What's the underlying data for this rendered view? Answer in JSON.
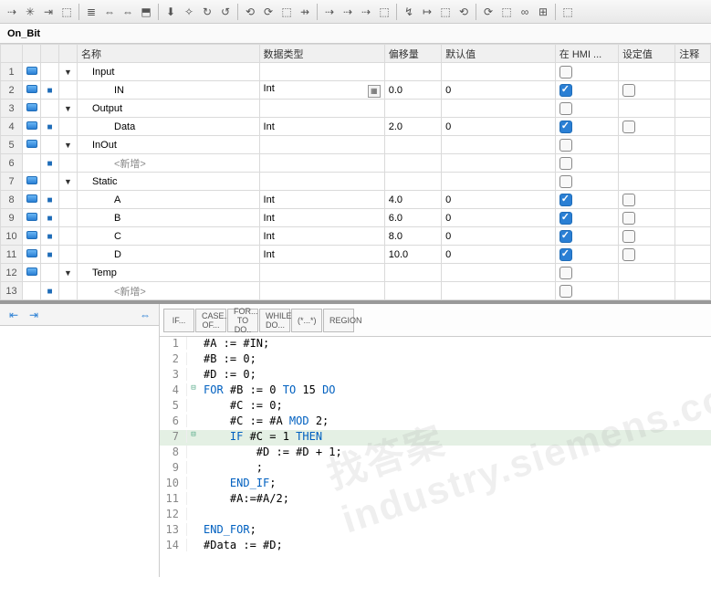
{
  "title": "On_Bit",
  "toolbar_icons": [
    "⇢",
    "✳",
    "⇥",
    "⬚",
    "≣",
    "⇔",
    "⇔",
    "⬒",
    "⬇",
    "✧",
    "↻",
    "↺",
    "⟲",
    "⟳",
    "⬚",
    "⇸",
    "⇢",
    "⇢",
    "⇢",
    "⬚",
    "↯",
    "↦",
    "⬚",
    "⟲",
    "⟳",
    "⬚",
    "∞",
    "⊞",
    "⬚"
  ],
  "columns": {
    "name": "名称",
    "type": "数据类型",
    "offset": "偏移量",
    "default": "默认值",
    "hmi": "在 HMI ...",
    "setpoint": "设定值",
    "comment": "注释"
  },
  "rows": [
    {
      "n": "1",
      "icon": "db",
      "tri": "▼",
      "name": "Input",
      "type": "",
      "off": "",
      "def": "",
      "hmi": false,
      "set": null,
      "ind": 1
    },
    {
      "n": "2",
      "icon": "db",
      "tri": "",
      "dot": true,
      "name": "IN",
      "type": "Int",
      "dd": true,
      "off": "0.0",
      "def": "0",
      "hmi": true,
      "set": false,
      "ind": 2
    },
    {
      "n": "3",
      "icon": "db",
      "tri": "▼",
      "name": "Output",
      "type": "",
      "off": "",
      "def": "",
      "hmi": false,
      "set": null,
      "ind": 1
    },
    {
      "n": "4",
      "icon": "db",
      "tri": "",
      "dot": true,
      "name": "Data",
      "type": "Int",
      "off": "2.0",
      "def": "0",
      "hmi": true,
      "set": false,
      "ind": 2
    },
    {
      "n": "5",
      "icon": "db",
      "tri": "▼",
      "name": "InOut",
      "type": "",
      "off": "",
      "def": "",
      "hmi": false,
      "set": null,
      "ind": 1
    },
    {
      "n": "6",
      "icon": "",
      "tri": "",
      "dot": true,
      "name": "<新增>",
      "type": "",
      "off": "",
      "def": "",
      "hmi": false,
      "set": null,
      "ind": 2,
      "new": true
    },
    {
      "n": "7",
      "icon": "db",
      "tri": "▼",
      "name": "Static",
      "type": "",
      "off": "",
      "def": "",
      "hmi": false,
      "set": null,
      "ind": 1
    },
    {
      "n": "8",
      "icon": "db",
      "tri": "",
      "dot": true,
      "name": "A",
      "type": "Int",
      "off": "4.0",
      "def": "0",
      "hmi": true,
      "set": false,
      "ind": 2
    },
    {
      "n": "9",
      "icon": "db",
      "tri": "",
      "dot": true,
      "name": "B",
      "type": "Int",
      "off": "6.0",
      "def": "0",
      "hmi": true,
      "set": false,
      "ind": 2
    },
    {
      "n": "10",
      "icon": "db",
      "tri": "",
      "dot": true,
      "name": "C",
      "type": "Int",
      "off": "8.0",
      "def": "0",
      "hmi": true,
      "set": false,
      "ind": 2
    },
    {
      "n": "11",
      "icon": "db",
      "tri": "",
      "dot": true,
      "name": "D",
      "type": "Int",
      "off": "10.0",
      "def": "0",
      "hmi": true,
      "set": false,
      "ind": 2
    },
    {
      "n": "12",
      "icon": "db",
      "tri": "▼",
      "name": "Temp",
      "type": "",
      "off": "",
      "def": "",
      "hmi": false,
      "set": null,
      "ind": 1
    },
    {
      "n": "13",
      "icon": "",
      "tri": "",
      "dot": true,
      "name": "<新增>",
      "type": "",
      "off": "",
      "def": "",
      "hmi": false,
      "set": null,
      "ind": 2,
      "new": true
    }
  ],
  "code_tabs": [
    "IF...",
    "CASE... OF...",
    "FOR... TO DO..",
    "WHILE.. DO...",
    "(*...*)",
    "REGION"
  ],
  "code_lines": [
    {
      "n": 1,
      "f": "",
      "txt": "#A := #IN;",
      "plain": true
    },
    {
      "n": 2,
      "f": "",
      "txt": "#B := 0;",
      "plain": true
    },
    {
      "n": 3,
      "f": "",
      "txt": "#D := 0;",
      "plain": true
    },
    {
      "n": 4,
      "f": "⊟",
      "html": "<span class='kw'>FOR</span> #B := 0 <span class='kw'>TO</span> 15 <span class='kw'>DO</span>"
    },
    {
      "n": 5,
      "f": "",
      "html": "    #C := 0;"
    },
    {
      "n": 6,
      "f": "",
      "html": "    #C := #A <span class='kw'>MOD</span> 2;"
    },
    {
      "n": 7,
      "f": "⊟",
      "html": "    <span class='kw'>IF</span> #C = 1 <span class='kw'>THEN</span>",
      "hl": true
    },
    {
      "n": 8,
      "f": "",
      "html": "        #D := #D + 1;"
    },
    {
      "n": 9,
      "f": "",
      "html": "        ;"
    },
    {
      "n": 10,
      "f": "",
      "html": "    <span class='kw'>END_IF</span>;"
    },
    {
      "n": 11,
      "f": "",
      "html": "    #A:=#A/2;"
    },
    {
      "n": 12,
      "f": "",
      "html": ""
    },
    {
      "n": 13,
      "f": "",
      "html": "<span class='kw'>END_FOR</span>;"
    },
    {
      "n": 14,
      "f": "",
      "html": "#Data := #D;"
    }
  ],
  "watermark": "找答案  industry.siemens.com"
}
